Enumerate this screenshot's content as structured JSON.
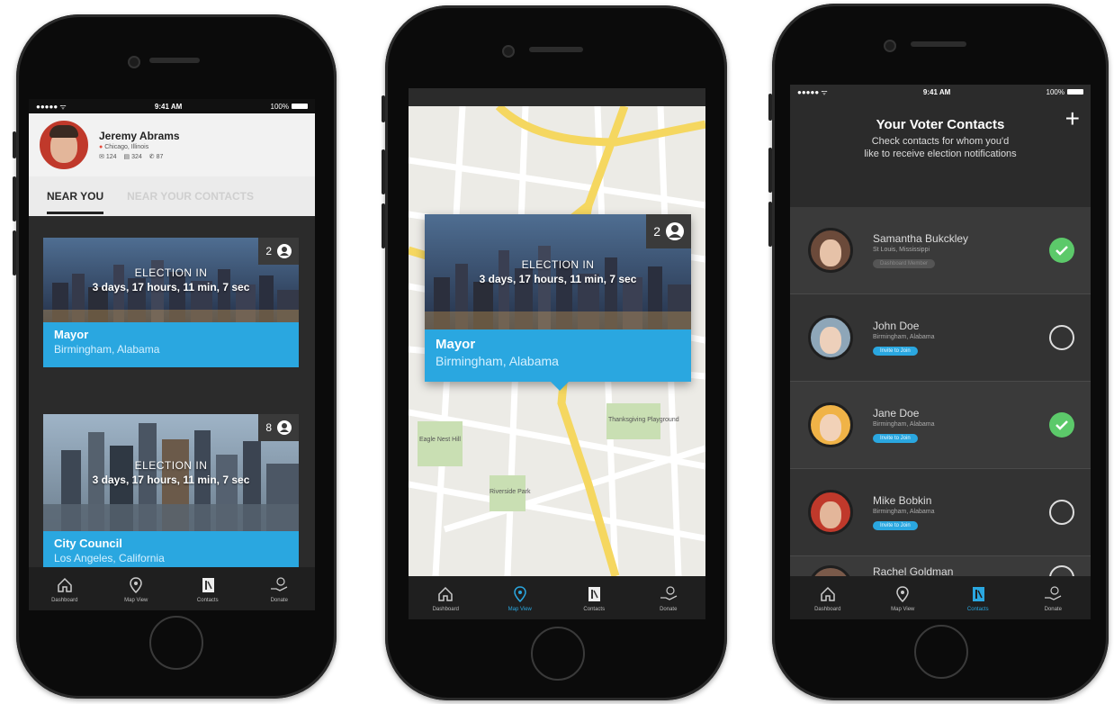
{
  "status": {
    "time": "9:41 AM",
    "battery": "100%",
    "signal": "●●●●● ᯤ"
  },
  "dashboard": {
    "user": {
      "name": "Jeremy Abrams",
      "location": "Chicago, Illinois",
      "stat1": "124",
      "stat2": "324",
      "stat3": "87"
    },
    "subtabs": [
      "NEAR YOU",
      "NEAR YOUR CONTACTS"
    ],
    "cards": [
      {
        "badge": "2",
        "election_label": "ELECTION IN",
        "countdown": "3 days, 17 hours, 11 min, 7 sec",
        "office": "Mayor",
        "place": "Birmingham, Alabama"
      },
      {
        "badge": "8",
        "election_label": "ELECTION IN",
        "countdown": "3 days, 17 hours, 11 min, 7 sec",
        "office": "City Council",
        "place": "Los Angeles, California"
      }
    ]
  },
  "map": {
    "popup": {
      "badge": "2",
      "election_label": "ELECTION IN",
      "countdown": "3 days, 17 hours, 11 min, 7 sec",
      "office": "Mayor",
      "place": "Birmingham, Alabama"
    },
    "places": [
      "Eagle Nest Hill",
      "Riverside Park",
      "Thanksgiving Playground"
    ]
  },
  "contacts": {
    "title": "Your Voter Contacts",
    "subtitle_line1": "Check contacts for whom you'd",
    "subtitle_line2": "like to receive election notifications",
    "plus": "+",
    "list": [
      {
        "name": "Samantha Bukckley",
        "location": "St Louis, Mississippi",
        "pill": "Dashboard Member",
        "checked": true
      },
      {
        "name": "John Doe",
        "location": "Birmingham, Alabama",
        "pill": "Invite to Join",
        "checked": false
      },
      {
        "name": "Jane Doe",
        "location": "Birmingham, Alabama",
        "pill": "Invite to Join",
        "checked": true
      },
      {
        "name": "Mike Bobkin",
        "location": "Birmingham, Alabama",
        "pill": "Invite to Join",
        "checked": false
      },
      {
        "name": "Rachel Goldman",
        "location": "",
        "pill": "",
        "checked": false
      }
    ]
  },
  "tabs": {
    "dashboard": "Dashboard",
    "map": "Map View",
    "contacts": "Contacts",
    "donate": "Donate"
  },
  "colors": {
    "accent": "#2aa7e0",
    "check_green": "#5cc96a",
    "dark_bg": "#2b2b2b"
  }
}
